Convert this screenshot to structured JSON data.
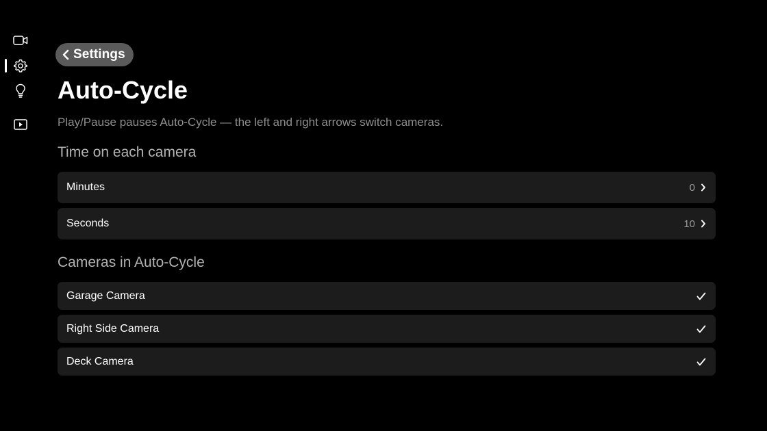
{
  "sidebar": {
    "items": [
      {
        "icon": "video-camera-icon"
      },
      {
        "icon": "gear-icon",
        "selected": true
      },
      {
        "icon": "lightbulb-icon"
      },
      {
        "icon": "play-video-icon"
      }
    ]
  },
  "header": {
    "back_label": "Settings",
    "title": "Auto-Cycle",
    "subtitle": "Play/Pause pauses Auto-Cycle — the left and right arrows switch cameras."
  },
  "time_section": {
    "header": "Time on each camera",
    "rows": [
      {
        "label": "Minutes",
        "value": "0"
      },
      {
        "label": "Seconds",
        "value": "10"
      }
    ]
  },
  "cameras_section": {
    "header": "Cameras in Auto-Cycle",
    "rows": [
      {
        "label": "Garage Camera",
        "checked": true
      },
      {
        "label": "Right Side Camera",
        "checked": true
      },
      {
        "label": "Deck Camera",
        "checked": true
      }
    ]
  },
  "colors": {
    "background": "#000000",
    "row_background": "#1c1c1c",
    "pill_background": "#5a5a5a",
    "subtitle_text": "#8e8e8e"
  }
}
